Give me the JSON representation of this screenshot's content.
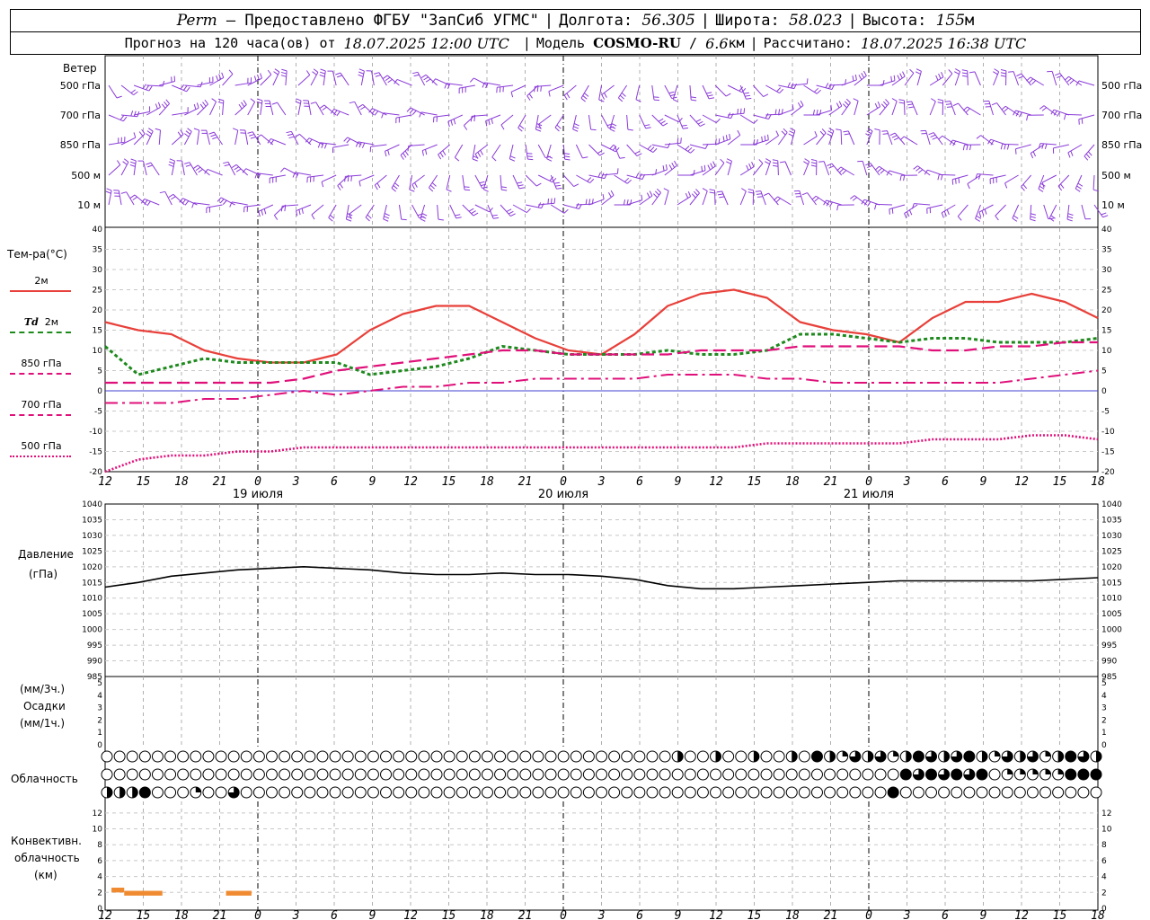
{
  "header": {
    "station": "Perm",
    "provider": "Предоставлено ФГБУ \"ЗапСиб УГМС\"",
    "lon_label": "Долгота:",
    "lon_value": "56.305",
    "lat_label": "Широта:",
    "lat_value": "58.023",
    "alt_label": "Высота:",
    "alt_value": "155",
    "alt_unit": "м",
    "forecast_prefix": "Прогноз на 120 часа(ов) от",
    "forecast_start": "18.07.2025 12:00 UTC",
    "model_label": "Модель",
    "model_name": "COSMO-RU",
    "model_res": "6.6",
    "model_res_unit": "км",
    "calc_label": "Рассчитано:",
    "calc_value": "18.07.2025 16:38 UTC"
  },
  "labels": {
    "wind": "Ветер",
    "wind_levels": [
      "500 гПа",
      "700 гПа",
      "850 гПа",
      "500  м",
      "10   м"
    ],
    "temp": "Тем-ра(°С)",
    "legend_2m": "2м",
    "legend_td_sym": "Td",
    "legend_td": "2м",
    "legend_850": "850 гПа",
    "legend_700": "700 гПа",
    "legend_500": "500 гПа",
    "pressure": "Давление",
    "pressure_unit": "(гПа)",
    "precip_top": "(мм/3ч.)",
    "precip": "Осадки",
    "precip_bottom": "(мм/1ч.)",
    "cloud": "Облачность",
    "conv1": "Конвективн.",
    "conv2": "облачность",
    "conv3": "(км)",
    "days": [
      "19 июля",
      "20 июля",
      "21 июля"
    ],
    "hour_ticks": [
      "12",
      "15",
      "18",
      "21",
      "0",
      "3",
      "6",
      "9",
      "12",
      "15",
      "18",
      "21",
      "0",
      "3",
      "6",
      "9",
      "12",
      "15",
      "18",
      "21",
      "0",
      "3",
      "6",
      "9",
      "12",
      "15",
      "18"
    ]
  },
  "colors": {
    "t2m": "#e8403a",
    "td2m": "#1e8a1e",
    "t850": "#e0107a",
    "t700": "#e0107a",
    "t500": "#e0107a",
    "wind": "#8a3ad8",
    "pressure": "#000000",
    "conv": "#f08a30",
    "zero": "#4040d0"
  },
  "chart_data": [
    {
      "type": "line",
      "title": "Тем-ра(°С)",
      "x_hours": [
        0,
        3,
        6,
        9,
        12,
        15,
        18,
        21,
        24,
        27,
        30,
        33,
        36,
        39,
        42,
        45,
        48,
        51,
        54,
        57,
        60,
        63,
        66,
        69,
        72,
        75,
        78
      ],
      "ylim": [
        -20,
        40
      ],
      "series": [
        {
          "name": "2м",
          "values": [
            17,
            15,
            14,
            10,
            8,
            7,
            7,
            9,
            15,
            19,
            21,
            21,
            17,
            13,
            10,
            9,
            14,
            21,
            24,
            25,
            23,
            17,
            15,
            14,
            12,
            18,
            22,
            22,
            24,
            22,
            18
          ]
        },
        {
          "name": "Td 2м",
          "values": [
            11,
            4,
            6,
            8,
            7,
            7,
            7,
            7,
            4,
            5,
            6,
            8,
            11,
            10,
            9,
            9,
            9,
            10,
            9,
            9,
            10,
            14,
            14,
            13,
            12,
            13,
            13,
            12,
            12,
            12,
            13
          ]
        },
        {
          "name": "850 гПа",
          "values": [
            2,
            2,
            2,
            2,
            2,
            2,
            3,
            5,
            6,
            7,
            8,
            9,
            10,
            10,
            9,
            9,
            9,
            9,
            10,
            10,
            10,
            11,
            11,
            11,
            11,
            10,
            10,
            11,
            11,
            12,
            12
          ]
        },
        {
          "name": "700 гПа",
          "values": [
            -3,
            -3,
            -3,
            -2,
            -2,
            -1,
            0,
            -1,
            0,
            1,
            1,
            2,
            2,
            3,
            3,
            3,
            3,
            4,
            4,
            4,
            3,
            3,
            2,
            2,
            2,
            2,
            2,
            2,
            3,
            4,
            5
          ]
        },
        {
          "name": "500 гПа",
          "values": [
            -20,
            -17,
            -16,
            -16,
            -15,
            -15,
            -14,
            -14,
            -14,
            -14,
            -14,
            -14,
            -14,
            -14,
            -14,
            -14,
            -14,
            -14,
            -14,
            -14,
            -13,
            -13,
            -13,
            -13,
            -13,
            -12,
            -12,
            -12,
            -11,
            -11,
            -12
          ]
        }
      ],
      "grid": true
    },
    {
      "type": "line",
      "title": "Давление",
      "ylabel": "(гПа)",
      "ylim": [
        985,
        1040
      ],
      "series": [
        {
          "name": "Давление",
          "values": [
            1013.5,
            1015,
            1017,
            1018,
            1019,
            1019.5,
            1020,
            1019.5,
            1019,
            1018,
            1017.5,
            1017.5,
            1018,
            1017.5,
            1017.5,
            1017,
            1016,
            1014,
            1013,
            1013,
            1013.5,
            1014,
            1014.5,
            1015,
            1015.5,
            1015.5,
            1015.5,
            1015.5,
            1015.5,
            1016,
            1016.5
          ]
        }
      ],
      "grid": true
    },
    {
      "type": "bar",
      "title": "Осадки",
      "ylim": [
        0,
        5
      ],
      "values": []
    },
    {
      "type": "bar",
      "title": "Конвективн. облачность",
      "ylabel": "(км)",
      "ylim": [
        0,
        13
      ],
      "bars": [
        {
          "from_h": 0.5,
          "to_h": 1.5,
          "top_km": 2.6
        },
        {
          "from_h": 1.5,
          "to_h": 4.5,
          "top_km": 2.2
        },
        {
          "from_h": 9.5,
          "to_h": 11.5,
          "top_km": 2.2
        }
      ]
    }
  ]
}
